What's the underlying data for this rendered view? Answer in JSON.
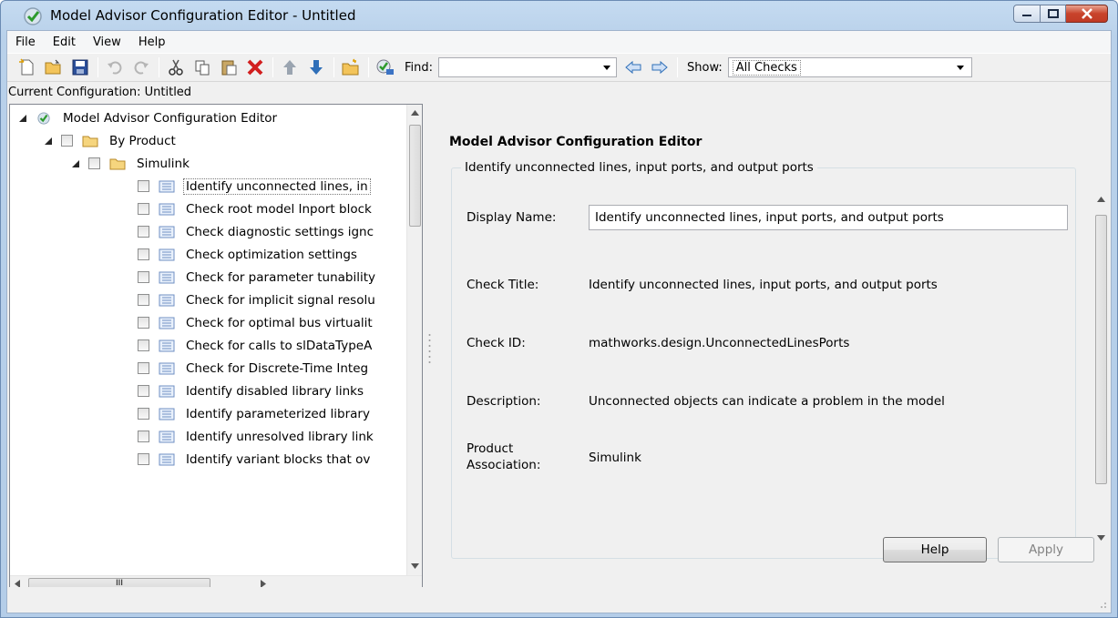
{
  "window": {
    "title": "Model Advisor Configuration Editor - Untitled"
  },
  "menu": [
    "File",
    "Edit",
    "View",
    "Help"
  ],
  "toolbar": {
    "find_label": "Find:",
    "find_value": "",
    "show_label": "Show:",
    "show_value": "All Checks"
  },
  "left": {
    "header": "Current Configuration: Untitled",
    "root": "Model Advisor Configuration Editor",
    "folder1": "By Product",
    "folder2": "Simulink",
    "checks": [
      "Identify unconnected lines, in",
      "Check root model Inport block",
      "Check diagnostic settings ignc",
      "Check optimization settings",
      "Check for parameter tunability",
      "Check for implicit signal resolu",
      "Check for optimal bus virtualit",
      "Check for calls to slDataTypeA",
      "Check for Discrete-Time Integ",
      "Identify disabled library links",
      "Identify parameterized library",
      "Identify unresolved library link",
      "Identify variant blocks that ov"
    ],
    "hscroll_grip": "III"
  },
  "right": {
    "title": "Model Advisor Configuration Editor",
    "group_title": "Identify unconnected lines, input ports, and output ports",
    "display_name_label": "Display Name:",
    "display_name_value": "Identify unconnected lines, input ports, and output ports",
    "check_title_label": "Check Title:",
    "check_title_value": "Identify unconnected lines, input ports, and output ports",
    "check_id_label": "Check ID:",
    "check_id_value": "mathworks.design.UnconnectedLinesPorts",
    "description_label": "Description:",
    "description_value": "Unconnected objects can indicate a problem in the model",
    "product_label_1": "Product",
    "product_label_2": "Association:",
    "product_value": "Simulink",
    "help_label": "Help",
    "apply_label": "Apply"
  },
  "colors": {
    "title_bar": "#b9d1ea",
    "close_button": "#c8432b",
    "delete_icon": "#d21e1e",
    "arrow_icons": "#2f6fb8"
  }
}
